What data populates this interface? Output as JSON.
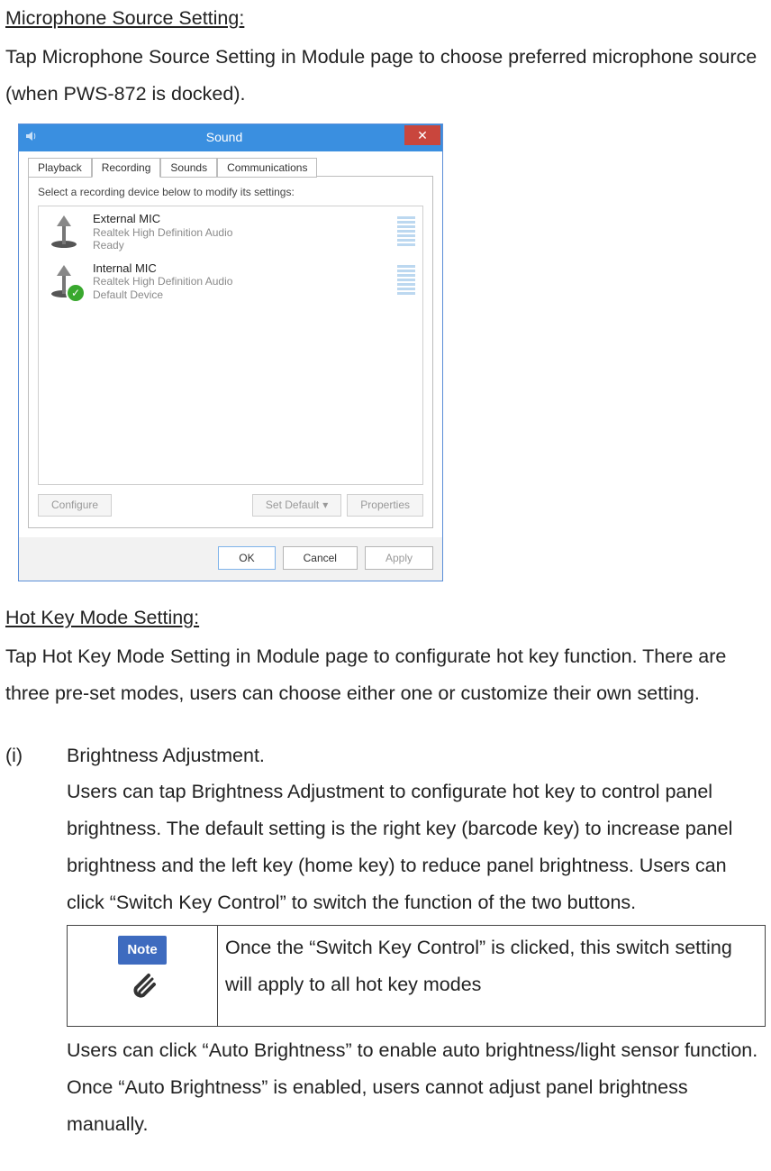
{
  "section_microphone": {
    "heading": "Microphone Source Setting:",
    "text": "Tap Microphone Source Setting in Module page to choose preferred microphone source (when PWS-872 is docked)."
  },
  "sound_dialog": {
    "title": "Sound",
    "close_glyph": "✕",
    "tabs": {
      "playback": "Playback",
      "recording": "Recording",
      "sounds": "Sounds",
      "communications": "Communications"
    },
    "hint": "Select a recording device below to modify its settings:",
    "devices": [
      {
        "name": "External MIC",
        "driver": "Realtek High Definition Audio",
        "status": "Ready",
        "default": false
      },
      {
        "name": "Internal MIC",
        "driver": "Realtek High Definition Audio",
        "status": "Default Device",
        "default": true
      }
    ],
    "buttons": {
      "configure": "Configure",
      "set_default": "Set Default",
      "properties": "Properties",
      "ok": "OK",
      "cancel": "Cancel",
      "apply": "Apply"
    }
  },
  "section_hotkey": {
    "heading": "Hot Key Mode Setting:",
    "text": "Tap Hot Key Mode Setting in Module page to configurate hot key function. There are three pre-set modes, users can choose either one or customize their own setting."
  },
  "item_i": {
    "label": "(i)",
    "title": "Brightness Adjustment.",
    "para1": "Users can tap Brightness Adjustment to configurate hot key to control panel brightness. The default setting is the right key (barcode key) to increase panel brightness and the left key (home key) to reduce panel brightness. Users can click “Switch Key Control” to switch the function of the two buttons.",
    "note_label": "Note",
    "note_text": "Once the “Switch Key Control” is clicked, this switch setting will apply to all hot key modes",
    "para2": "Users can click “Auto Brightness” to enable auto brightness/light sensor function. Once “Auto Brightness” is enabled, users cannot adjust panel brightness manually."
  }
}
